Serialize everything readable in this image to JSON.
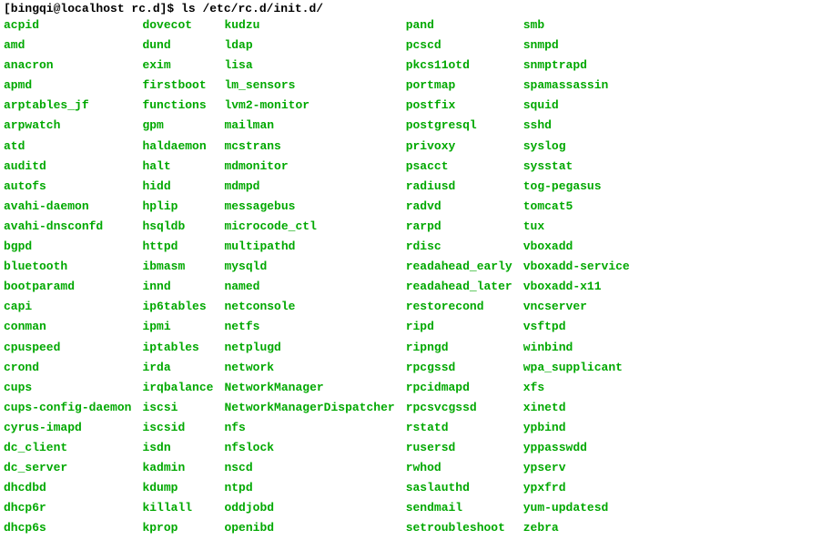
{
  "prompt_user_host": "[bingqi@localhost rc.d]$ ",
  "command": "ls /etc/rc.d/init.d/",
  "columns": [
    [
      "acpid",
      "amd",
      "anacron",
      "apmd",
      "arptables_jf",
      "arpwatch",
      "atd",
      "auditd",
      "autofs",
      "avahi-daemon",
      "avahi-dnsconfd",
      "bgpd",
      "bluetooth",
      "bootparamd",
      "capi",
      "conman",
      "cpuspeed",
      "crond",
      "cups",
      "cups-config-daemon",
      "cyrus-imapd",
      "dc_client",
      "dc_server",
      "dhcdbd",
      "dhcp6r",
      "dhcp6s"
    ],
    [
      "dovecot",
      "dund",
      "exim",
      "firstboot",
      "functions",
      "gpm",
      "haldaemon",
      "halt",
      "hidd",
      "hplip",
      "hsqldb",
      "httpd",
      "ibmasm",
      "innd",
      "ip6tables",
      "ipmi",
      "iptables",
      "irda",
      "irqbalance",
      "iscsi",
      "iscsid",
      "isdn",
      "kadmin",
      "kdump",
      "killall",
      "kprop"
    ],
    [
      "kudzu",
      "ldap",
      "lisa",
      "lm_sensors",
      "lvm2-monitor",
      "mailman",
      "mcstrans",
      "mdmonitor",
      "mdmpd",
      "messagebus",
      "microcode_ctl",
      "multipathd",
      "mysqld",
      "named",
      "netconsole",
      "netfs",
      "netplugd",
      "network",
      "NetworkManager",
      "NetworkManagerDispatcher",
      "nfs",
      "nfslock",
      "nscd",
      "ntpd",
      "oddjobd",
      "openibd"
    ],
    [
      "pand",
      "pcscd",
      "pkcs11otd",
      "portmap",
      "postfix",
      "postgresql",
      "privoxy",
      "psacct",
      "radiusd",
      "radvd",
      "rarpd",
      "rdisc",
      "readahead_early",
      "readahead_later",
      "restorecond",
      "ripd",
      "ripngd",
      "rpcgssd",
      "rpcidmapd",
      "rpcsvcgssd",
      "rstatd",
      "rusersd",
      "rwhod",
      "saslauthd",
      "sendmail",
      "setroubleshoot"
    ],
    [
      "smb",
      "snmpd",
      "snmptrapd",
      "spamassassin",
      "squid",
      "sshd",
      "syslog",
      "sysstat",
      "tog-pegasus",
      "tomcat5",
      "tux",
      "vboxadd",
      "vboxadd-service",
      "vboxadd-x11",
      "vncserver",
      "vsftpd",
      "winbind",
      "wpa_supplicant",
      "xfs",
      "xinetd",
      "ypbind",
      "yppasswdd",
      "ypserv",
      "ypxfrd",
      "yum-updatesd",
      "zebra"
    ]
  ]
}
